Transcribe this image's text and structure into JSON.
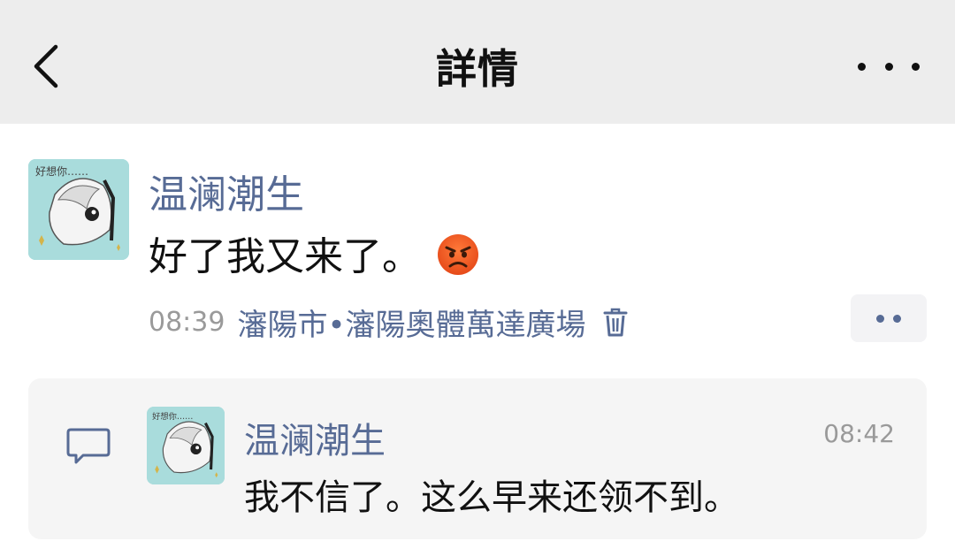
{
  "header": {
    "title": "詳情",
    "back_icon": "chevron-left-icon",
    "more_icon": "more-horizontal-icon"
  },
  "post": {
    "author": "温澜潮生",
    "text": "好了我又来了。",
    "emoji": "angry-face-emoji",
    "time": "08:39",
    "location": "瀋陽市•瀋陽奧體萬達廣場",
    "delete_icon": "trash-icon",
    "action_icon": "two-dots-icon"
  },
  "comment": {
    "icon": "comment-bubble-icon",
    "author": "温澜潮生",
    "time": "08:42",
    "text": "我不信了。这么早来还领不到。"
  },
  "avatar": {
    "caption": "好想你……"
  },
  "colors": {
    "header_bg": "#ededed",
    "link_blue": "#576b95",
    "panel_bg": "#f5f5f5",
    "meta_gray": "#9a9a9a",
    "avatar_bg": "#a9dcdc"
  }
}
